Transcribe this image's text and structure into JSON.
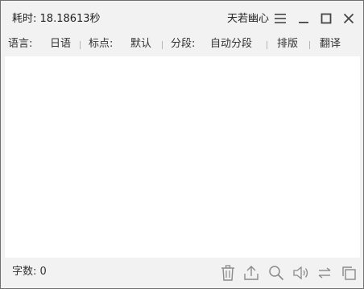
{
  "titlebar": {
    "elapsed_label": "耗时:",
    "elapsed_value": "18.18613秒",
    "user_name": "天若幽心",
    "menu_icon": "hamburger-menu-icon",
    "minimize_icon": "minimize-icon",
    "maximize_icon": "maximize-icon",
    "close_icon": "close-icon"
  },
  "options": {
    "language_label": "语言:",
    "language_value": "日语",
    "punctuation_label": "标点:",
    "punctuation_value": "默认",
    "segment_label": "分段:",
    "segment_value": "自动分段",
    "layout_label": "排版",
    "translate_label": "翻译"
  },
  "editor": {
    "text": ""
  },
  "statusbar": {
    "count_label": "字数:",
    "count_value": "0",
    "icons": [
      "trash-icon",
      "share-icon",
      "search-icon",
      "speaker-icon",
      "swap-icon",
      "copy-icon"
    ]
  },
  "colors": {
    "chrome_bg": "#f2f2f2",
    "editor_bg": "#ffffff",
    "border": "#6f6f6f",
    "icon": "#8a8a8a",
    "text": "#333333"
  }
}
